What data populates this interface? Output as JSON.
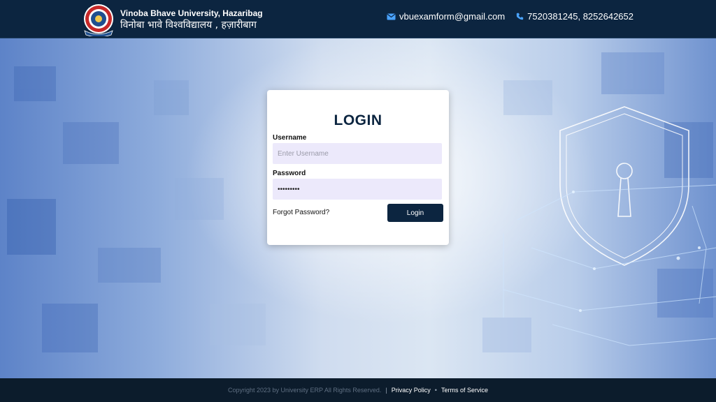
{
  "header": {
    "university_name_en": "Vinoba Bhave University, Hazaribag",
    "university_name_hi": "विनोबा भावे विश्वविद्यालय , हज़ारीबाग",
    "email": "vbuexamform@gmail.com",
    "phones": "7520381245, 8252642652",
    "icons": {
      "email": "envelope-icon",
      "phone": "phone-icon",
      "logo": "university-seal"
    }
  },
  "login": {
    "title": "LOGIN",
    "username_label": "Username",
    "username_placeholder": "Enter Username",
    "username_value": "",
    "password_label": "Password",
    "password_value": "•••••••••",
    "forgot_link": "Forgot Password?",
    "submit_label": "Login"
  },
  "footer": {
    "copyright": "Copyright 2023 by University ERP All Rights Reserved.",
    "separator_1": "|",
    "privacy_link": "Privacy Policy",
    "separator_2": "•",
    "terms_link": "Terms of Service"
  },
  "colors": {
    "navy": "#0c2540",
    "input_bg": "#ece9fb",
    "footer_bg": "#0c1c2c",
    "hero_blue": "#5d83c8"
  }
}
